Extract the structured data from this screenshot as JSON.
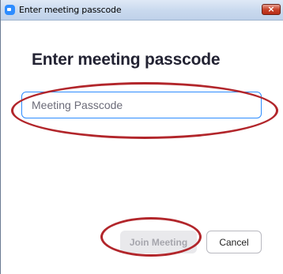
{
  "window": {
    "title": "Enter meeting passcode",
    "close_glyph": "×"
  },
  "dialog": {
    "heading": "Enter meeting passcode",
    "passcode_input": {
      "value": "",
      "placeholder": "Meeting Passcode"
    },
    "join_label": "Join Meeting",
    "cancel_label": "Cancel"
  },
  "colors": {
    "accent": "#2d8cff",
    "annotation_ring": "#b2262b",
    "disabled_button_bg": "#e9e9ec"
  },
  "icons": {
    "app": "zoom-app-icon",
    "close": "close-icon"
  }
}
